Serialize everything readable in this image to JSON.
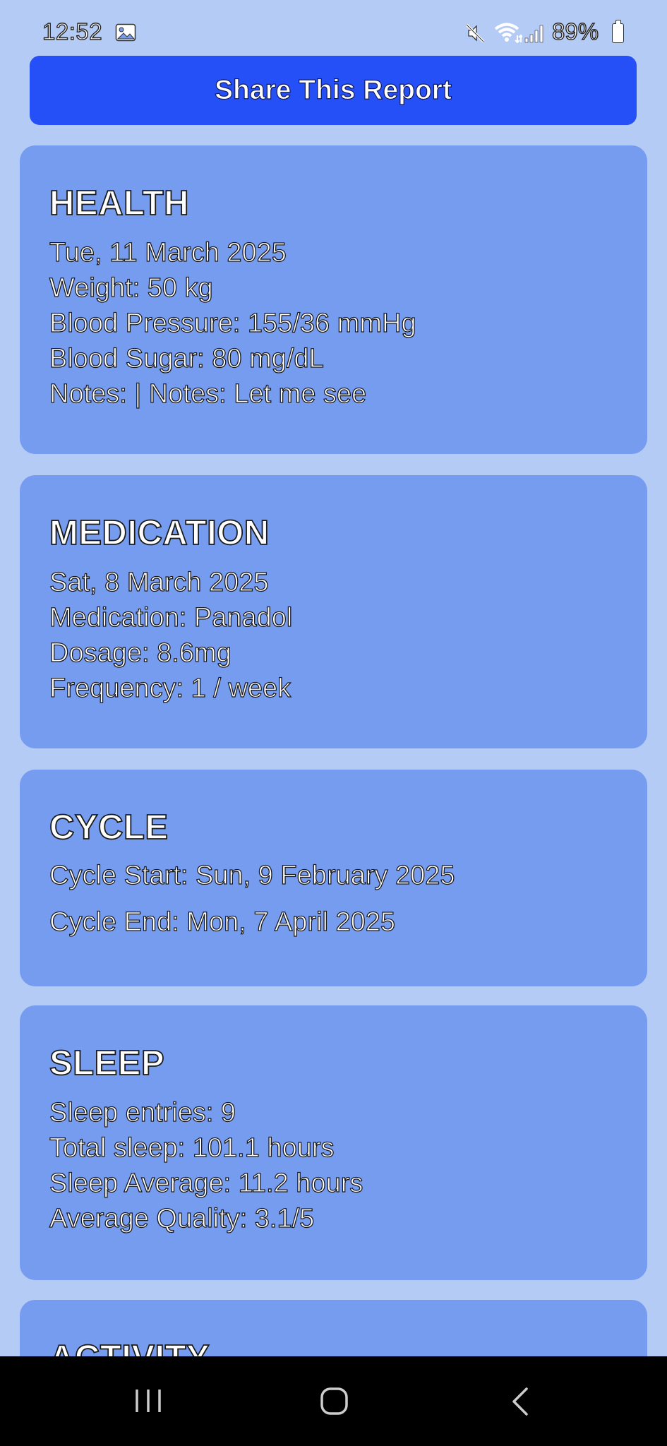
{
  "status_bar": {
    "time": "12:52",
    "battery": "89%",
    "icons": [
      "gallery-icon",
      "mute-icon",
      "wifi-icon",
      "signal-icon",
      "battery-icon"
    ]
  },
  "share_button": {
    "label": "Share This Report"
  },
  "health": {
    "title": "HEALTH",
    "date": "Tue, 11 March 2025",
    "weight": "Weight: 50 kg",
    "blood_pressure": "Blood Pressure: 155/36 mmHg",
    "blood_sugar": "Blood Sugar: 80 mg/dL",
    "notes": "Notes:  | Notes: Let me see"
  },
  "medication": {
    "title": "MEDICATION",
    "date": "Sat, 8 March 2025",
    "medication": "Medication: Panadol",
    "dosage": "Dosage: 8.6mg",
    "frequency": "Frequency: 1 / week"
  },
  "cycle": {
    "title": "CYCLE",
    "start": "Cycle Start: Sun, 9 February 2025",
    "end": "Cycle End: Mon, 7 April 2025"
  },
  "sleep": {
    "title": "SLEEP",
    "entries": "Sleep entries: 9",
    "total": "Total sleep: 101.1 hours",
    "average": "Sleep Average: 11.2 hours",
    "quality": "Average Quality: 3.1/5"
  },
  "activity": {
    "title": "ACTIVITY"
  },
  "colors": {
    "background": "#b4cbf5",
    "card": "#769cf0",
    "button": "#2650f7",
    "nav_bar": "#000000"
  },
  "nav": {
    "icons": [
      "recent-apps-icon",
      "home-icon",
      "back-icon"
    ]
  }
}
